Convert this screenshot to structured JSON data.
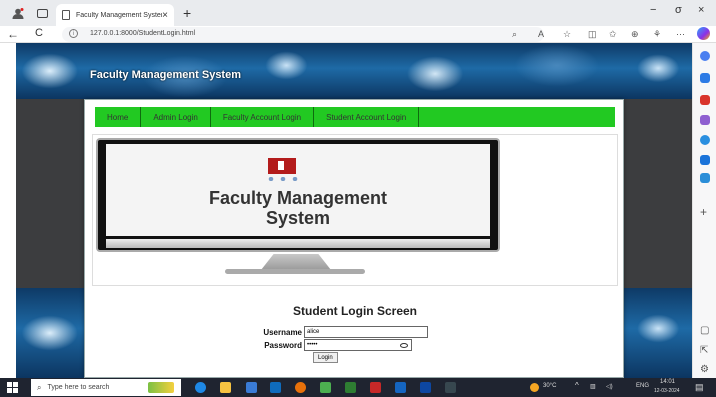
{
  "browser": {
    "tab_title": "Faculty Management System",
    "tab_close": "×",
    "new_tab": "+",
    "url": "127.0.0.1:8000/StudentLogin.html",
    "back": "←",
    "refresh": "C",
    "window_controls": [
      "−",
      "σ",
      "×"
    ]
  },
  "page": {
    "site_title": "Faculty Management System",
    "nav": [
      {
        "label": "Home"
      },
      {
        "label": "Admin Login"
      },
      {
        "label": "Faculty Account Login"
      },
      {
        "label": "Student Account Login"
      }
    ],
    "banner": {
      "line1": "Faculty Management",
      "line2": "System"
    },
    "login": {
      "title": "Student Login Screen",
      "username_label": "Username",
      "username_value": "alice",
      "password_label": "Password",
      "password_value": "•••••",
      "button": "Login"
    }
  },
  "taskbar": {
    "search_placeholder": "Type here to search",
    "weather": "30°C",
    "language": "ENG",
    "time": "14:01",
    "date": "12-03-2024"
  },
  "colors": {
    "nav_green": "#22c922",
    "banner_red": "#b31b1b",
    "page_blue": "#1e6aa6"
  }
}
